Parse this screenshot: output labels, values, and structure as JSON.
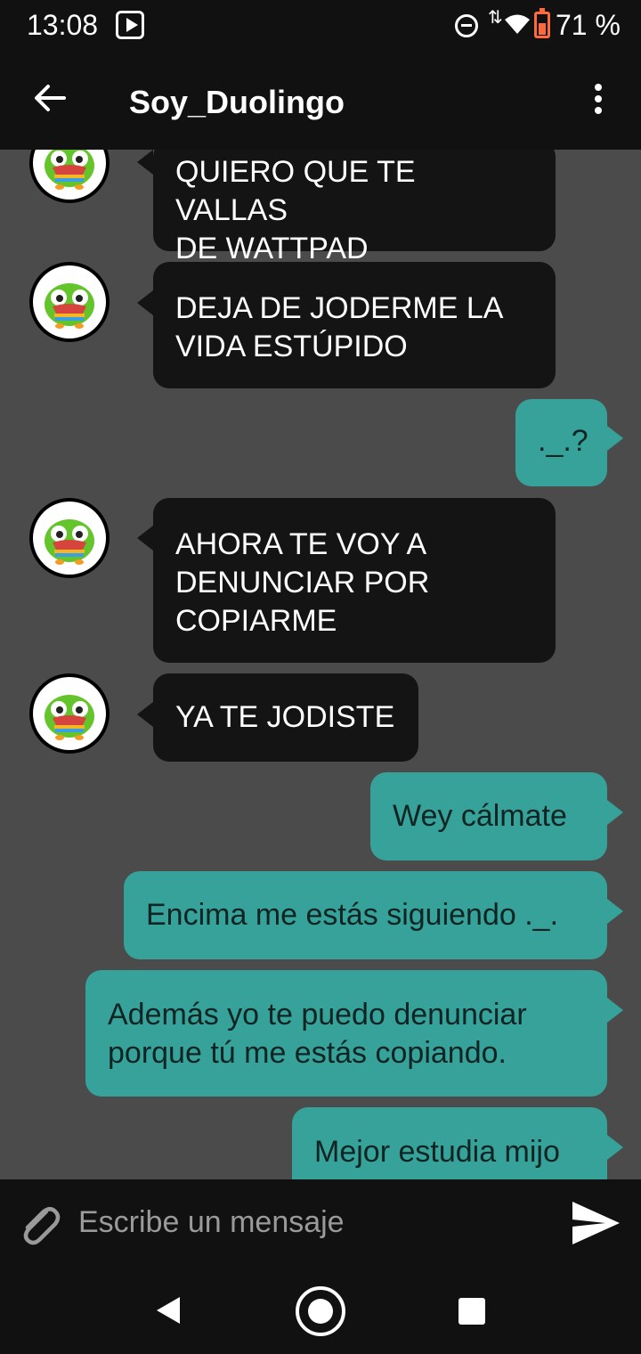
{
  "status_bar": {
    "time": "13:08",
    "battery": "71 %"
  },
  "app_bar": {
    "title": "Soy_Duolingo"
  },
  "messages": [
    {
      "from": "in",
      "text": "QUIERO QUE TE VALLAS\nDE WATTPAD"
    },
    {
      "from": "in",
      "text": "DEJA DE JODERME LA\nVIDA ESTÚPIDO"
    },
    {
      "from": "out",
      "text": "._.?"
    },
    {
      "from": "in",
      "text": "AHORA TE VOY A\nDENUNCIAR POR\nCOPIARME"
    },
    {
      "from": "in",
      "text": "YA TE JODISTE"
    },
    {
      "from": "out",
      "text": "Wey cálmate"
    },
    {
      "from": "out",
      "text": "Encima me estás siguiendo ._."
    },
    {
      "from": "out",
      "text": "Además yo te puedo denunciar\nporque tú me estás copiando."
    },
    {
      "from": "out",
      "text": "Mejor estudia mijo"
    }
  ],
  "input": {
    "placeholder": "Escribe un mensaje"
  },
  "icons": {
    "back": "arrow-left-icon",
    "more": "more-vertical-icon",
    "attach": "paperclip-icon",
    "send": "send-icon",
    "avatar": "duolingo-owl-avatar"
  },
  "colors": {
    "incoming_bubble": "#141414",
    "outgoing_bubble": "#36a29a",
    "background": "#4b4b4b",
    "bars": "#111111"
  }
}
